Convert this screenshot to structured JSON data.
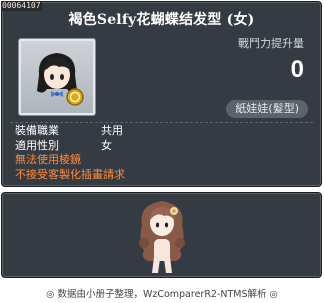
{
  "item_id": "00064107",
  "title": "褐色Selfy花蝴蝶结发型 (女)",
  "power_label": "戰鬥力提升量",
  "power_value": "0",
  "category": "紙娃娃(髮型)",
  "stats": [
    {
      "label": "裝備職業",
      "value": "共用"
    },
    {
      "label": "適用性別",
      "value": "女"
    }
  ],
  "warnings": [
    "無法使用棱鏡",
    "不接受客製化插畫請求"
  ],
  "footer": "◎ 数据由小册子整理，WzComparerR2-NTMS解析 ◎",
  "colors": {
    "panel_bg": "#353b42",
    "warning_text": "#ff8a3c",
    "hair": "#8a5a48"
  }
}
